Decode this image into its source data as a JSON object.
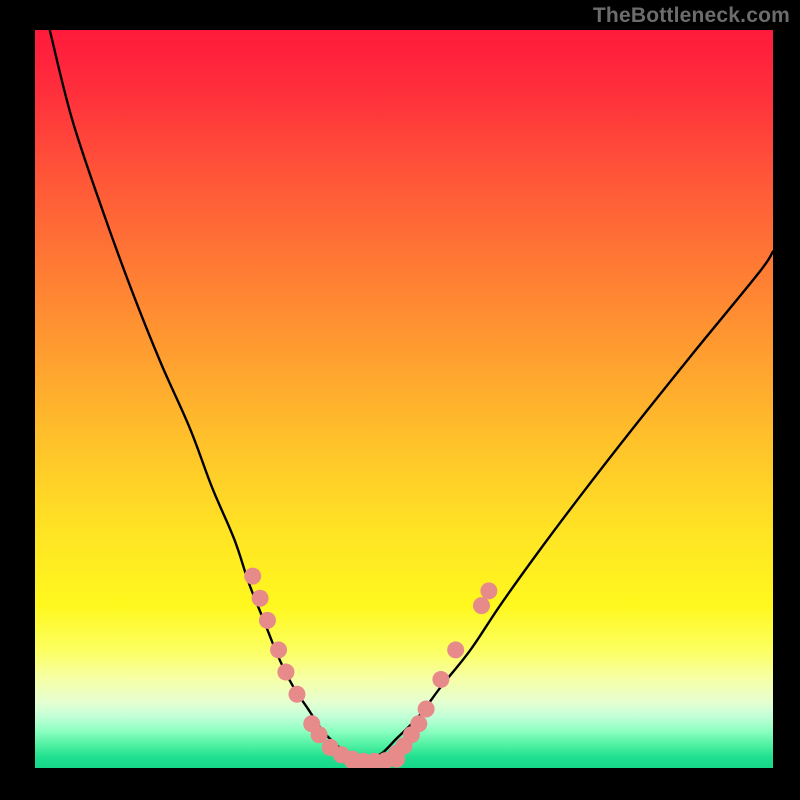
{
  "watermark": "TheBottleneck.com",
  "colors": {
    "background": "#000000",
    "curve": "#000000",
    "dot_fill": "#e68a8a",
    "dot_stroke": "#d06a6a"
  },
  "chart_data": {
    "type": "line",
    "title": "",
    "xlabel": "",
    "ylabel": "",
    "xlim": [
      0,
      100
    ],
    "ylim": [
      0,
      100
    ],
    "series": [
      {
        "name": "left-curve",
        "x": [
          2,
          5,
          9,
          13,
          17,
          21,
          24,
          27,
          29,
          31,
          33,
          35,
          37,
          39,
          41,
          43
        ],
        "y": [
          100,
          88,
          76,
          65,
          55,
          46,
          38,
          31,
          25,
          20,
          15,
          11,
          8,
          5,
          3,
          1
        ]
      },
      {
        "name": "right-curve",
        "x": [
          45,
          47,
          49,
          52,
          55,
          59,
          63,
          68,
          74,
          81,
          89,
          98,
          100
        ],
        "y": [
          1,
          2,
          4,
          7,
          11,
          16,
          22,
          29,
          37,
          46,
          56,
          67,
          70
        ]
      }
    ],
    "scatter": [
      {
        "name": "left-dots",
        "points": [
          {
            "x": 29.5,
            "y": 26
          },
          {
            "x": 30.5,
            "y": 23
          },
          {
            "x": 31.5,
            "y": 20
          },
          {
            "x": 33.0,
            "y": 16
          },
          {
            "x": 34.0,
            "y": 13
          },
          {
            "x": 35.5,
            "y": 10
          },
          {
            "x": 37.5,
            "y": 6
          },
          {
            "x": 38.5,
            "y": 4.5
          },
          {
            "x": 40.0,
            "y": 2.8
          },
          {
            "x": 41.5,
            "y": 1.8
          },
          {
            "x": 43.0,
            "y": 1.2
          }
        ]
      },
      {
        "name": "bottom-dots",
        "points": [
          {
            "x": 43.0,
            "y": 1.0
          },
          {
            "x": 44.5,
            "y": 0.9
          },
          {
            "x": 46.0,
            "y": 0.9
          },
          {
            "x": 47.5,
            "y": 1.0
          },
          {
            "x": 49.0,
            "y": 1.2
          }
        ]
      },
      {
        "name": "right-dots",
        "points": [
          {
            "x": 49.0,
            "y": 2.0
          },
          {
            "x": 50.0,
            "y": 3.0
          },
          {
            "x": 51.0,
            "y": 4.5
          },
          {
            "x": 52.0,
            "y": 6.0
          },
          {
            "x": 53.0,
            "y": 8.0
          },
          {
            "x": 55.0,
            "y": 12.0
          },
          {
            "x": 57.0,
            "y": 16.0
          },
          {
            "x": 60.5,
            "y": 22.0
          },
          {
            "x": 61.5,
            "y": 24.0
          }
        ]
      }
    ]
  }
}
